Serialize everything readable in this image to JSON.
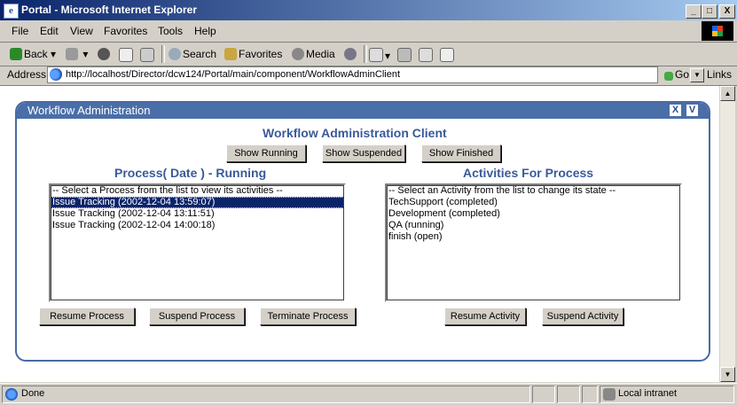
{
  "window": {
    "title": "Portal - Microsoft Internet Explorer",
    "controls": [
      "_",
      "□",
      "X"
    ]
  },
  "menu": [
    "File",
    "Edit",
    "View",
    "Favorites",
    "Tools",
    "Help"
  ],
  "toolbar": {
    "back": "Back",
    "search": "Search",
    "favorites": "Favorites",
    "media": "Media"
  },
  "address": {
    "label": "Address",
    "url": "http://localhost/Director/dcw124/Portal/main/component/WorkflowAdminClient",
    "go": "Go",
    "links": "Links"
  },
  "portlet": {
    "title": "Workflow Administration",
    "close_glyph": "X",
    "min_glyph": "V",
    "heading": "Workflow Administration Client",
    "show_buttons": [
      "Show Running",
      "Show Suspended",
      "Show Finished"
    ],
    "process_heading": "Process( Date ) - Running",
    "activities_heading": "Activities For Process",
    "process_list": [
      "-- Select a Process from the list to view its activities --",
      "Issue Tracking (2002-12-04 13:59:07)",
      "Issue Tracking (2002-12-04 13:11:51)",
      "Issue Tracking (2002-12-04 14:00:18)"
    ],
    "process_selected_index": 1,
    "activity_list": [
      "-- Select an Activity from the list to change its state --",
      "TechSupport (completed)",
      "Development (completed)",
      "QA (running)",
      "finish (open)"
    ],
    "process_buttons": [
      "Resume Process",
      "Suspend Process",
      "Terminate Process"
    ],
    "activity_buttons": [
      "Resume Activity",
      "Suspend Activity"
    ]
  },
  "status": {
    "text": "Done",
    "zone": "Local intranet"
  },
  "colors": {
    "titlebar": "#0a246a",
    "portlet_header": "#4a6ea8",
    "heading": "#3a5a9a",
    "selection": "#0a246a"
  }
}
